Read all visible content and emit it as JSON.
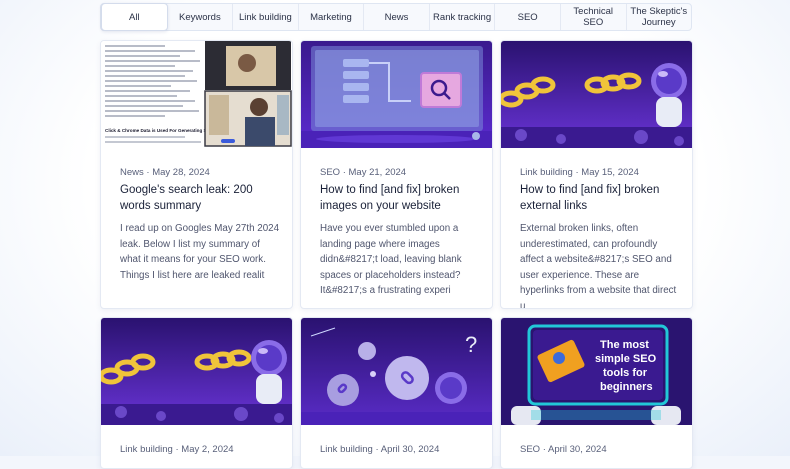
{
  "filters": {
    "tabs": [
      "All",
      "Keywords",
      "Link building",
      "Marketing",
      "News",
      "Rank tracking",
      "SEO",
      "Technical SEO",
      "The Skeptic's\nJourney"
    ],
    "active": "All"
  },
  "cards": [
    {
      "category": "News",
      "date": "May 28, 2024",
      "title": "Google's search leak: 200 words summary",
      "excerpt": "I read up on Googles May 27th 2024 leak. Below I list my summary of what it means for your SEO work. Things I list here are leaked realit",
      "thumb_heading": "Click & Chrome Data is Used For Generating Sitelinks"
    },
    {
      "category": "SEO",
      "date": "May 21, 2024",
      "title": "How to find [and fix] broken images on your website",
      "excerpt": "Have you ever stumbled upon a landing page where images didn&#8217;t load, leaving blank spaces or placeholders instead? It&#8217;s a frustrating experi"
    },
    {
      "category": "Link building",
      "date": "May 15, 2024",
      "title": "How to find [and fix] broken external links",
      "excerpt": "External broken links, often underestimated, can profoundly affect a website&#8217;s SEO and user experience. These are hyperlinks from a website that direct u"
    },
    {
      "category": "Link building",
      "date": "May 2, 2024",
      "title": "",
      "excerpt": ""
    },
    {
      "category": "Link building",
      "date": "April 30, 2024",
      "title": "",
      "excerpt": ""
    },
    {
      "category": "SEO",
      "date": "April 30, 2024",
      "title": "",
      "excerpt": "",
      "thumb_text": "The most\nsimple SEO\ntools for\nbeginners"
    }
  ],
  "colors": {
    "accent": "#3b5bdb",
    "purple_dark": "#2a1a6e",
    "purple": "#5a2fc4",
    "chain_gold": "#f0c43a"
  }
}
